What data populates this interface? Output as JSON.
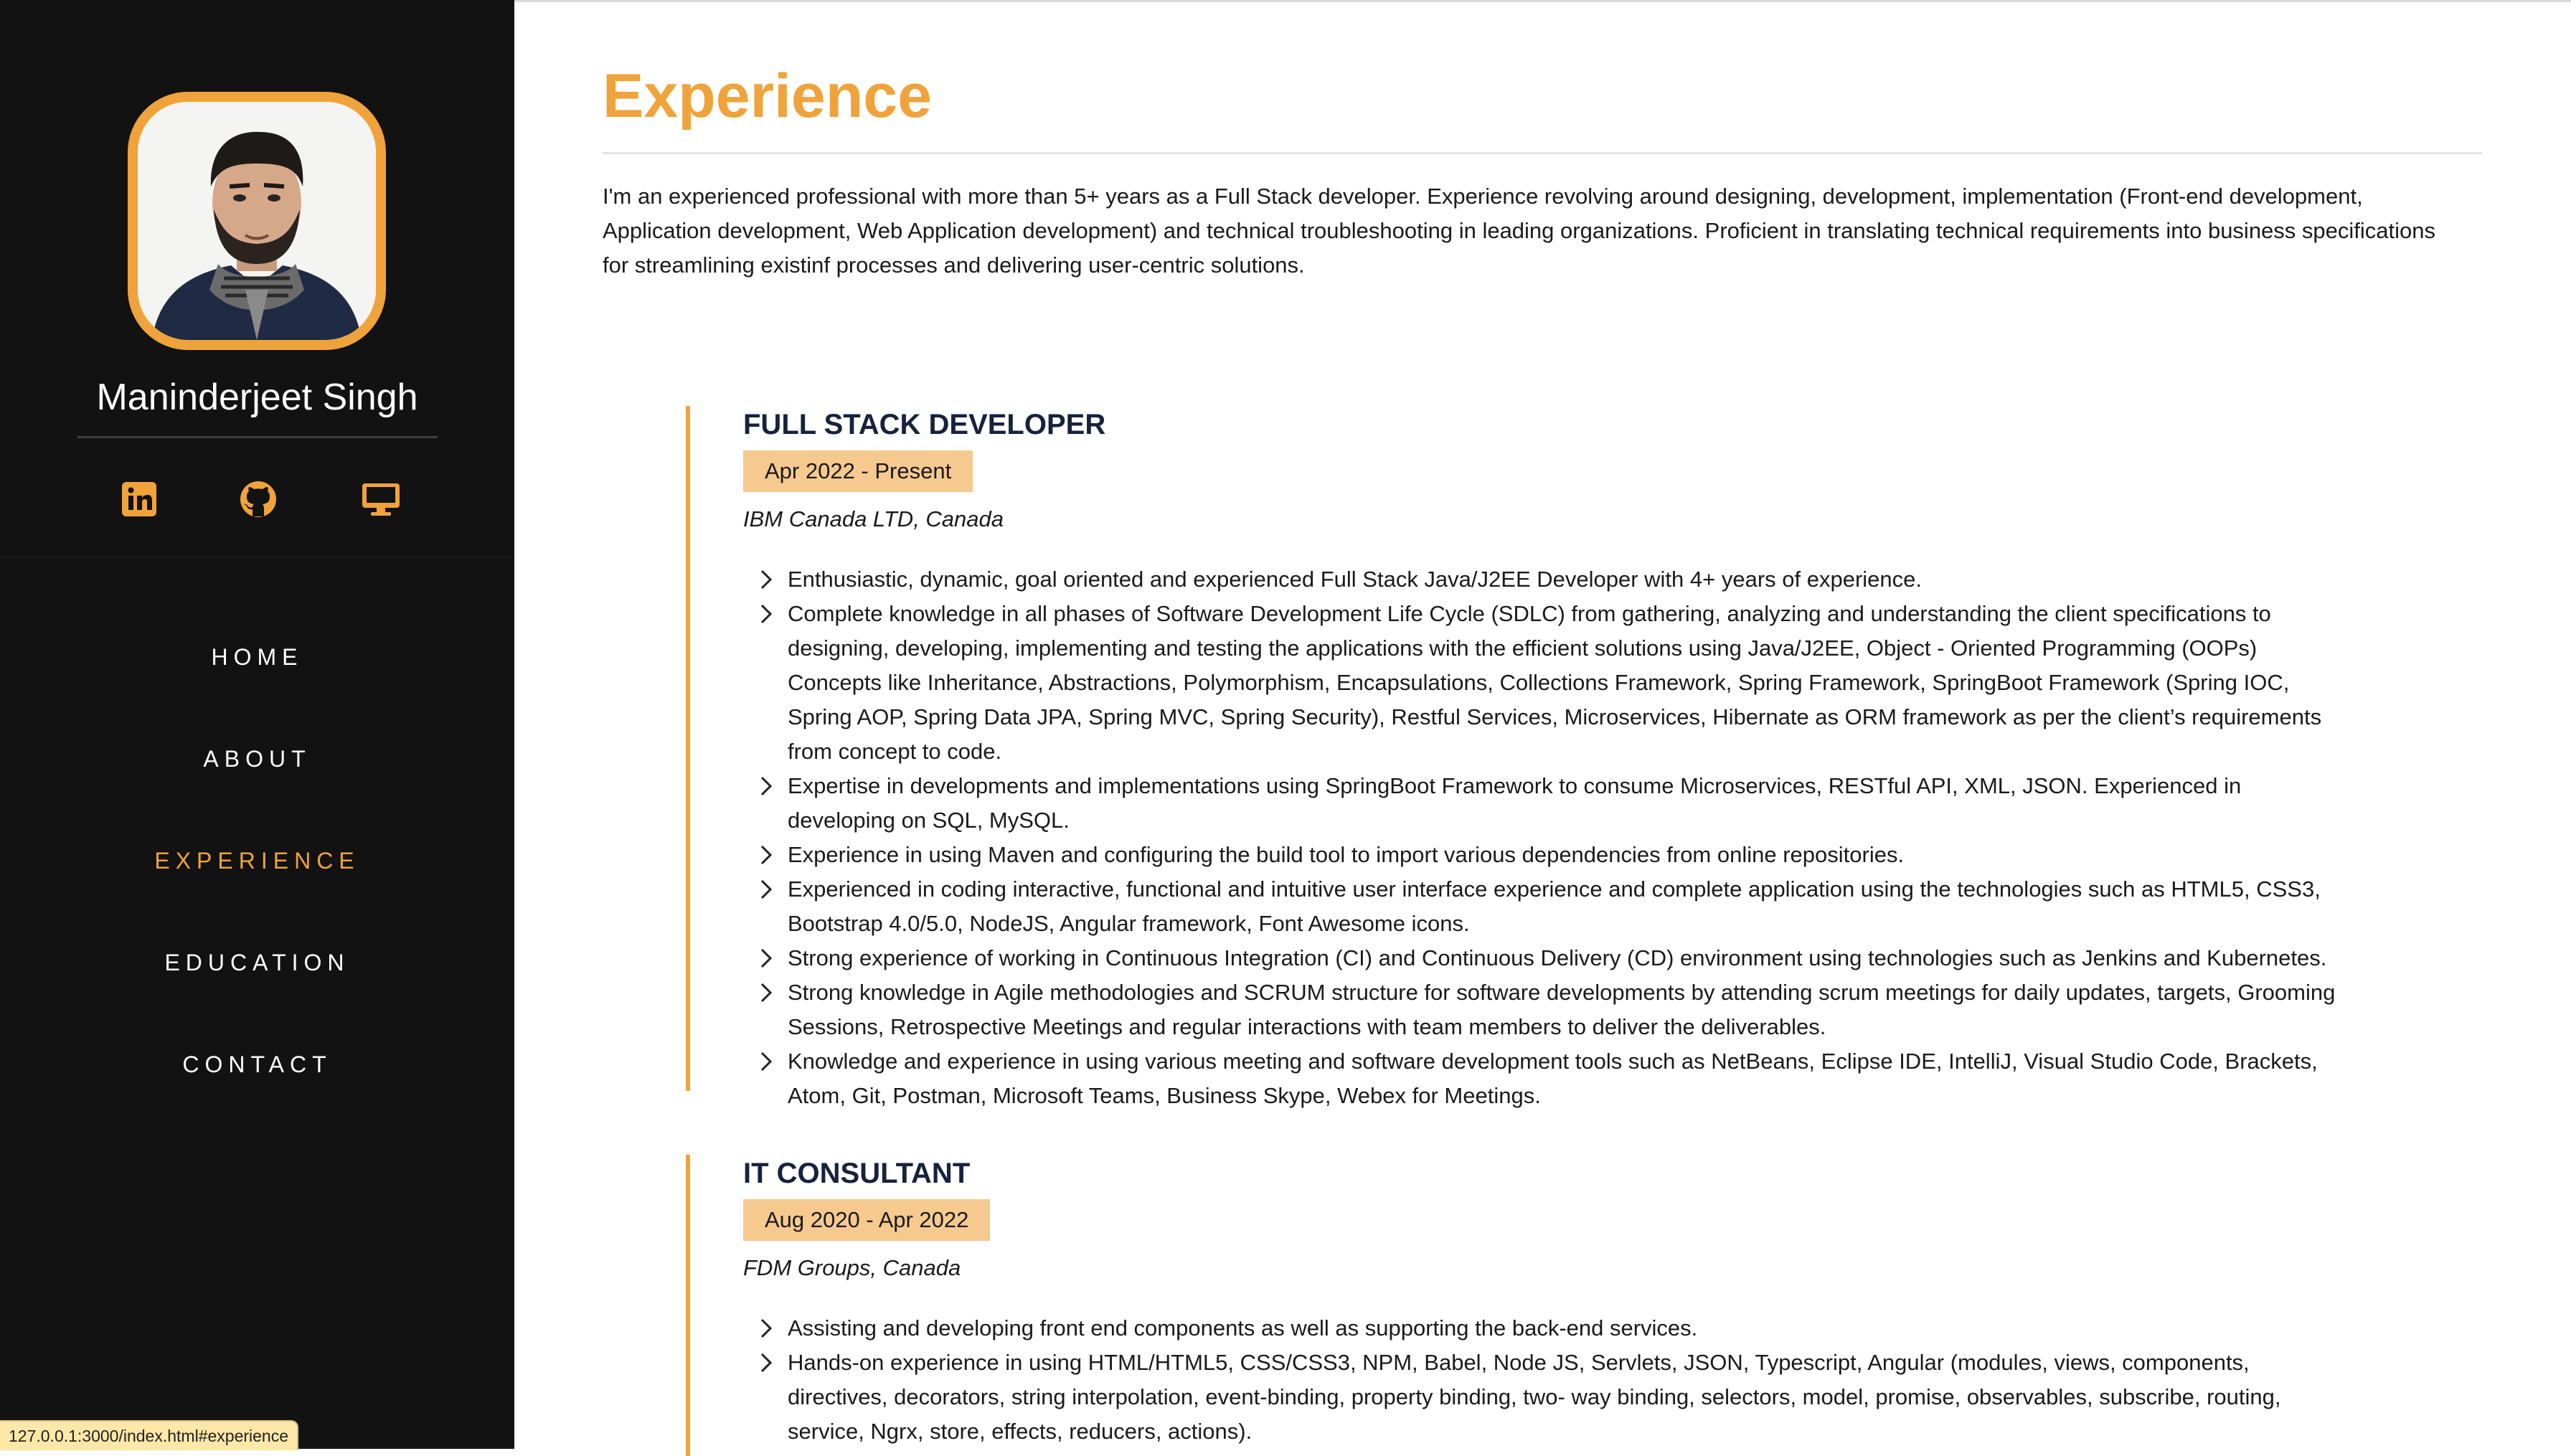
{
  "profile": {
    "name": "Maninderjeet Singh"
  },
  "social": {
    "icons": [
      "linkedin-icon",
      "github-icon",
      "desktop-icon"
    ]
  },
  "nav": {
    "items": [
      "HOME",
      "ABOUT",
      "EXPERIENCE",
      "EDUCATION",
      "CONTACT"
    ],
    "active": "EXPERIENCE"
  },
  "colors": {
    "accent": "#f0a33a",
    "sidebar_bg": "#121212",
    "date_badge_bg": "#f6c98f",
    "job_title": "#17233d"
  },
  "page": {
    "title": "Experience",
    "intro": "I'm an experienced professional with more than 5+ years as a Full Stack developer. Experience revolving around designing, development, implementation (Front-end development, Application development, Web Application development) and technical troubleshooting in leading organizations. Proficient in translating technical requirements into business specifications for streamlining existinf processes and delivering user-centric solutions."
  },
  "jobs": [
    {
      "title": "FULL STACK DEVELOPER",
      "dates": "Apr 2022 - Present",
      "company": "IBM Canada LTD, Canada",
      "bullets": [
        "Enthusiastic, dynamic, goal oriented and experienced Full Stack Java/J2EE Developer with 4+ years of experience.",
        "Complete knowledge in all phases of Software Development Life Cycle (SDLC) from gathering, analyzing and understanding the client specifications to designing, developing, implementing and testing the applications with the efficient solutions using Java/J2EE, Object - Oriented Programming (OOPs) Concepts like Inheritance, Abstractions, Polymorphism, Encapsulations, Collections Framework, Spring Framework, SpringBoot Framework (Spring IOC, Spring AOP, Spring Data JPA, Spring MVC, Spring Security), Restful Services, Microservices, Hibernate as ORM framework as per the client’s requirements from concept to code.",
        "Expertise in developments and implementations using SpringBoot Framework to consume Microservices, RESTful API, XML, JSON. Experienced in developing on SQL, MySQL.",
        "Experience in using Maven and configuring the build tool to import various dependencies from online repositories.",
        "Experienced in coding interactive, functional and intuitive user interface experience and complete application using the technologies such as HTML5, CSS3, Bootstrap 4.0/5.0, NodeJS, Angular framework, Font Awesome icons.",
        "Strong experience of working in Continuous Integration (CI) and Continuous Delivery (CD) environment using technologies such as Jenkins and Kubernetes.",
        "Strong knowledge in Agile methodologies and SCRUM structure for software developments by attending scrum meetings for daily updates, targets, Grooming Sessions, Retrospective Meetings and regular interactions with team members to deliver the deliverables.",
        "Knowledge and experience in using various meeting and software development tools such as NetBeans, Eclipse IDE, IntelliJ, Visual Studio Code, Brackets, Atom, Git, Postman, Microsoft Teams, Business Skype, Webex for Meetings."
      ]
    },
    {
      "title": "IT CONSULTANT",
      "dates": "Aug 2020 - Apr 2022",
      "company": "FDM Groups, Canada",
      "bullets": [
        "Assisting and developing front end components as well as supporting the back-end services.",
        "Hands-on experience in using HTML/HTML5, CSS/CSS3, NPM, Babel, Node JS, Servlets, JSON, Typescript, Angular (modules, views, components, directives, decorators, string interpolation, event-binding, property binding, two- way binding, selectors, model, promise, observables, subscribe, routing, service, Ngrx, store, effects, reducers, actions)."
      ]
    }
  ],
  "status_bar": {
    "url": "127.0.0.1:3000/index.html#experience"
  }
}
